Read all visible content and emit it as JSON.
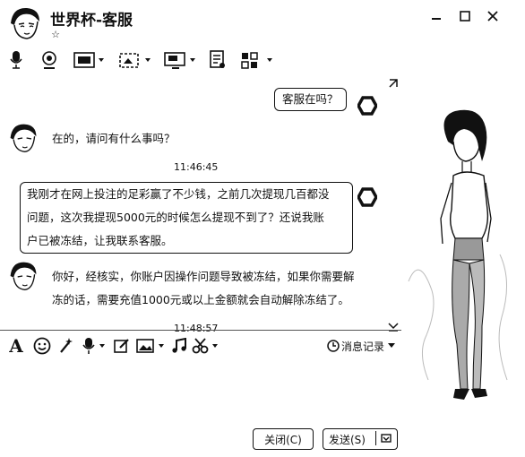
{
  "window": {
    "title": "世界杯-客服",
    "status_icon": "star-outline-icon",
    "controls": [
      "minimize-icon",
      "maximize-icon",
      "close-icon"
    ]
  },
  "toolbar": {
    "icons": [
      "microphone-icon",
      "webcam-icon",
      "screen-share-icon",
      "file-transfer-icon",
      "remote-desktop-icon",
      "document-icon",
      "apps-grid-icon"
    ]
  },
  "messages": [
    {
      "from": "me",
      "text": "客服在吗？"
    },
    {
      "from": "service",
      "text": "在的，请问有什么事吗？"
    },
    {
      "type": "time",
      "text": "11:46:45"
    },
    {
      "from": "me",
      "lines": [
        "我刚才在网上投注的足彩赢了不少钱，之前几次提现几百都没",
        "问题，这次我提现5000元的时候怎么提现不到了？还说我账",
        "户已被冻结，让我联系客服。"
      ]
    },
    {
      "from": "service",
      "lines": [
        "你好，经核实，你账户因操作问题导致被冻结，如果你需要解",
        "冻的话，需要充值1000元或以上金额就会自动解除冻结了。"
      ]
    },
    {
      "type": "time",
      "text": "11:48:57"
    }
  ],
  "editor_toolbar": {
    "icons": [
      "font-icon",
      "emoji-icon",
      "magic-wand-icon",
      "voice-icon",
      "edit-icon",
      "image-icon",
      "music-icon",
      "scissors-icon"
    ],
    "history_label": "消息记录"
  },
  "buttons": {
    "close_label": "关闭(C)",
    "send_label": "发送(S)"
  }
}
